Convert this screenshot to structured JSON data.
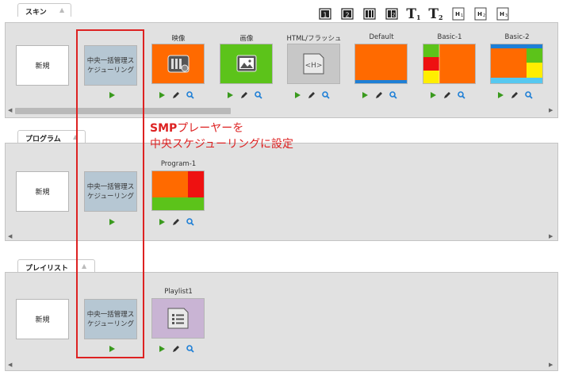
{
  "skin": {
    "tab_label": "スキン",
    "new_label": "新規",
    "central_label": "中央一括管理スケジューリング",
    "items": [
      {
        "label": "映像",
        "thumb": "video"
      },
      {
        "label": "画像",
        "thumb": "image"
      },
      {
        "label": "HTML/フラッシュ",
        "thumb": "html"
      },
      {
        "label": "Default",
        "thumb": "default"
      },
      {
        "label": "Basic-1",
        "thumb": "basic1"
      },
      {
        "label": "Basic-2",
        "thumb": "basic2"
      }
    ],
    "html_icon_text": "<H>"
  },
  "toolbar": {
    "icons": [
      {
        "name": "layout-1-icon",
        "text": "1"
      },
      {
        "name": "layout-2-icon",
        "text": "2"
      },
      {
        "name": "layout-3-icon",
        "text": ""
      },
      {
        "name": "layout-4-icon",
        "text": "2"
      },
      {
        "name": "text-1-icon",
        "text": "T",
        "sub": "1"
      },
      {
        "name": "text-2-icon",
        "text": "T",
        "sub": "2"
      },
      {
        "name": "heading-1-icon",
        "text": "H",
        "sub": "1"
      },
      {
        "name": "heading-2-icon",
        "text": "H",
        "sub": "2"
      },
      {
        "name": "heading-3-icon",
        "text": "H",
        "sub": "3"
      }
    ]
  },
  "program": {
    "tab_label": "プログラム",
    "new_label": "新規",
    "central_label": "中央一括管理スケジューリング",
    "items": [
      {
        "label": "Program-1"
      }
    ]
  },
  "playlist": {
    "tab_label": "プレイリスト",
    "new_label": "新規",
    "central_label": "中央一括管理スケジューリング",
    "items": [
      {
        "label": "Playlist1"
      }
    ]
  },
  "annotation": {
    "line1_bold": "SMP",
    "line1_rest": "プレーヤーを",
    "line2": "中央スケジューリングに設定"
  },
  "colors": {
    "orange": "#ff6a00",
    "green": "#5cc31a",
    "red": "#ee1111",
    "yellow": "#ffee00",
    "blue": "#1e7fd6",
    "purple": "#c9b4d4",
    "annotation_red": "#dd2222"
  }
}
